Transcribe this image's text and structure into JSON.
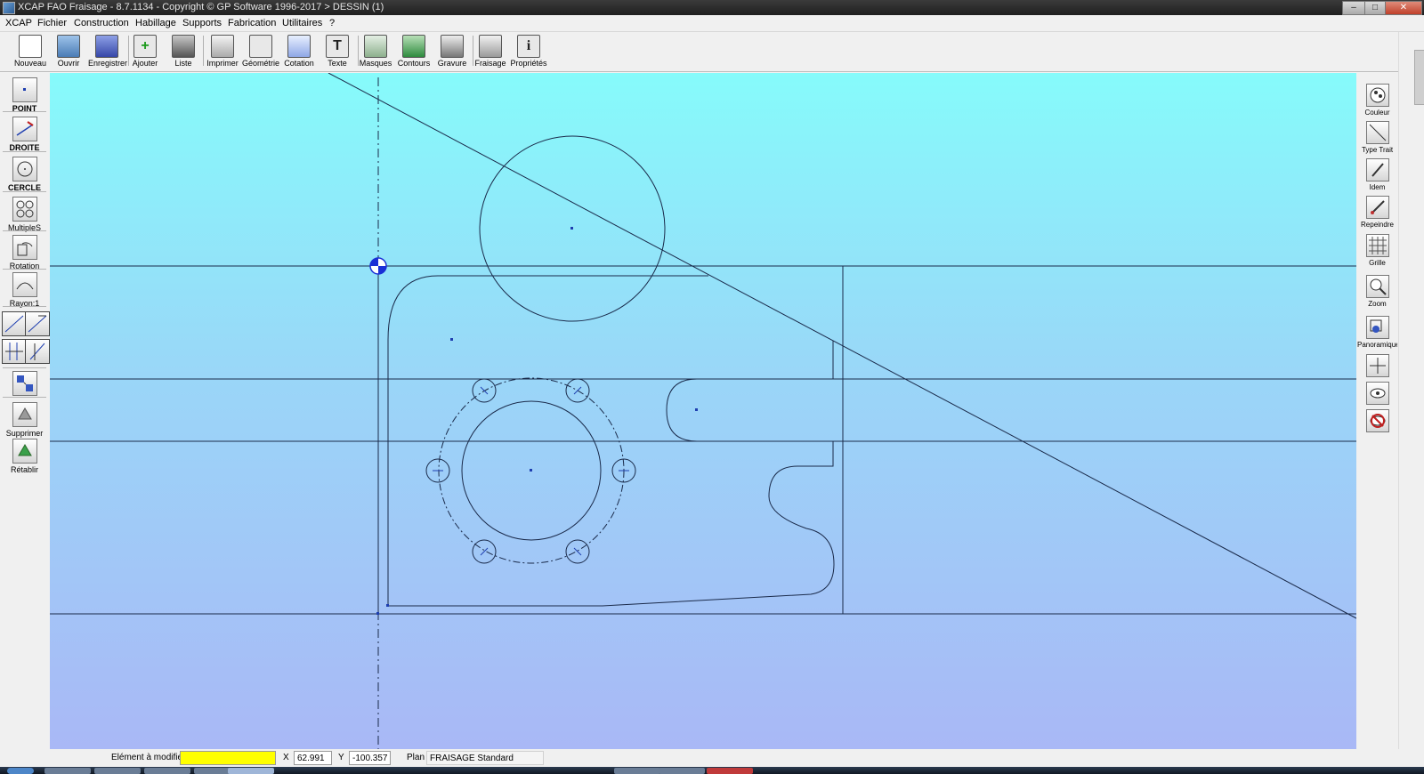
{
  "window": {
    "title": "XCAP FAO Fraisage - 8.7.1134 - Copyright © GP Software 1996-2017 > DESSIN (1)",
    "controls": {
      "minimize": "–",
      "maximize": "□",
      "close": "✕"
    }
  },
  "menu": [
    "XCAP",
    "Fichier",
    "Construction",
    "Habillage",
    "Supports",
    "Fabrication",
    "Utilitaires",
    "?"
  ],
  "toolbar": [
    {
      "label": "Nouveau",
      "icon": "new-document-icon",
      "glyph": ""
    },
    {
      "label": "Ouvrir",
      "icon": "open-folder-icon",
      "glyph": ""
    },
    {
      "label": "Enregistrer",
      "icon": "floppy-disk-icon",
      "glyph": ""
    },
    {
      "label": "Ajouter",
      "icon": "add-file-icon",
      "glyph": "+"
    },
    {
      "label": "Liste",
      "icon": "list-icon",
      "glyph": ""
    },
    {
      "label": "Imprimer",
      "icon": "printer-icon",
      "glyph": ""
    },
    {
      "label": "Géométrie",
      "icon": "geometry-icon",
      "glyph": ""
    },
    {
      "label": "Cotation",
      "icon": "dimension-icon",
      "glyph": ""
    },
    {
      "label": "Texte",
      "icon": "text-icon",
      "glyph": "T"
    },
    {
      "label": "Masques",
      "icon": "masks-icon",
      "glyph": ""
    },
    {
      "label": "Contours",
      "icon": "contours-icon",
      "glyph": ""
    },
    {
      "label": "Gravure",
      "icon": "engraving-icon",
      "glyph": ""
    },
    {
      "label": "Fraisage",
      "icon": "milling-machine-icon",
      "glyph": ""
    },
    {
      "label": "Propriétés",
      "icon": "info-icon",
      "glyph": "i"
    }
  ],
  "left_tools": [
    {
      "label": "POINT",
      "icon": "point-icon"
    },
    {
      "label": "DROITE",
      "icon": "line-icon"
    },
    {
      "label": "CERCLE",
      "icon": "circle-icon"
    },
    {
      "label": "MultipleS",
      "icon": "multiple-icon"
    },
    {
      "label": "Rotation",
      "icon": "rotation-icon"
    },
    {
      "label": "Rayon:1",
      "icon": "radius-icon"
    },
    {
      "label": "Supprimer",
      "icon": "delete-icon"
    },
    {
      "label": "Rétablir",
      "icon": "restore-icon"
    }
  ],
  "right_tools": [
    {
      "label": "Couleur",
      "icon": "color-icon"
    },
    {
      "label": "Type Trait",
      "icon": "line-type-icon"
    },
    {
      "label": "Idem",
      "icon": "eyedropper-icon"
    },
    {
      "label": "Repeindre",
      "icon": "repaint-brush-icon"
    },
    {
      "label": "Grille",
      "icon": "grid-icon"
    },
    {
      "label": "Zoom",
      "icon": "zoom-icon"
    },
    {
      "label": "Panoramique",
      "icon": "pan-icon"
    },
    {
      "label": "",
      "icon": "move-arrows-icon"
    },
    {
      "label": "",
      "icon": "eye-icon"
    },
    {
      "label": "",
      "icon": "hide-eye-icon"
    }
  ],
  "status": {
    "element_label": "Elément à modifier",
    "element_value": "",
    "x_label": "X",
    "x_value": "62.991",
    "y_label": "Y",
    "y_value": "-100.357",
    "plan_label": "Plan",
    "plan_value": "FRAISAGE Standard"
  },
  "colors": {
    "canvas_top": "#86fbfb",
    "canvas_bottom": "#a9b8f6",
    "element_field": "#ffff00",
    "origin_marker": "#1a2fd6"
  }
}
